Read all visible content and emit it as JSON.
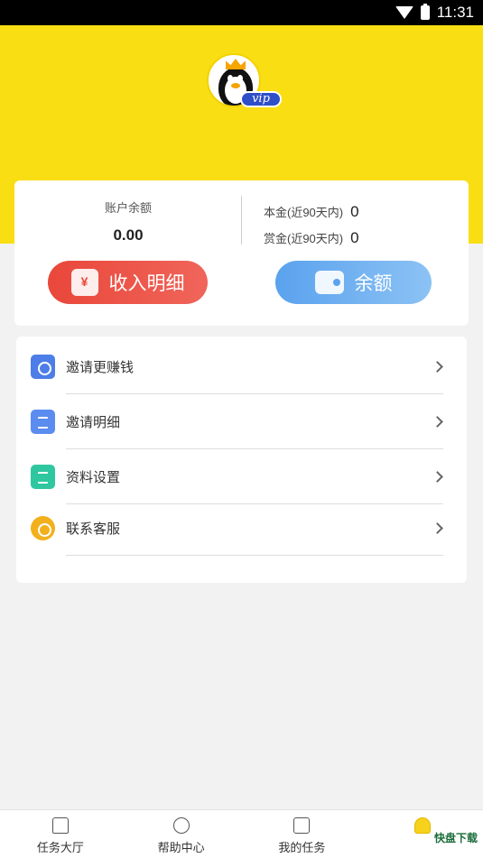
{
  "status_bar": {
    "time": "11:31"
  },
  "header": {
    "vip_label": "vip"
  },
  "balance": {
    "account_label": "账户余额",
    "account_value": "0.00",
    "principal_label": "本金(近90天内)",
    "principal_value": "0",
    "reward_label": "赏金(近90天内)",
    "reward_value": "0"
  },
  "buttons": {
    "income_label": "收入明细",
    "balance_label": "余额"
  },
  "menu": {
    "items": [
      {
        "label": "邀请更赚钱",
        "icon": "invite-user-icon"
      },
      {
        "label": "邀请明细",
        "icon": "document-icon"
      },
      {
        "label": "资料设置",
        "icon": "id-card-icon"
      },
      {
        "label": "联系客服",
        "icon": "headset-icon"
      }
    ]
  },
  "tabbar": {
    "tabs": [
      {
        "label": "任务大厅",
        "icon": "home-icon"
      },
      {
        "label": "帮助中心",
        "icon": "lightbulb-icon"
      },
      {
        "label": "我的任务",
        "icon": "task-list-icon"
      },
      {
        "label": "",
        "icon": "user-icon"
      }
    ]
  },
  "watermark": "快盘下载",
  "colors": {
    "header_bg": "#f9de14",
    "income_btn": "#e9473a",
    "balance_btn": "#5aa2ee"
  }
}
